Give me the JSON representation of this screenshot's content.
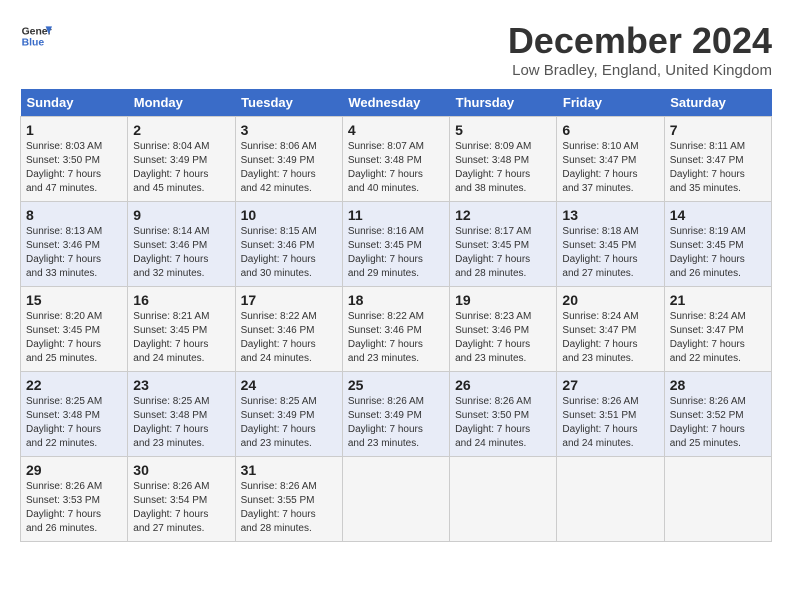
{
  "header": {
    "logo_line1": "General",
    "logo_line2": "Blue",
    "title": "December 2024",
    "subtitle": "Low Bradley, England, United Kingdom"
  },
  "days_of_week": [
    "Sunday",
    "Monday",
    "Tuesday",
    "Wednesday",
    "Thursday",
    "Friday",
    "Saturday"
  ],
  "weeks": [
    [
      {
        "day": "1",
        "info": "Sunrise: 8:03 AM\nSunset: 3:50 PM\nDaylight: 7 hours\nand 47 minutes."
      },
      {
        "day": "2",
        "info": "Sunrise: 8:04 AM\nSunset: 3:49 PM\nDaylight: 7 hours\nand 45 minutes."
      },
      {
        "day": "3",
        "info": "Sunrise: 8:06 AM\nSunset: 3:49 PM\nDaylight: 7 hours\nand 42 minutes."
      },
      {
        "day": "4",
        "info": "Sunrise: 8:07 AM\nSunset: 3:48 PM\nDaylight: 7 hours\nand 40 minutes."
      },
      {
        "day": "5",
        "info": "Sunrise: 8:09 AM\nSunset: 3:48 PM\nDaylight: 7 hours\nand 38 minutes."
      },
      {
        "day": "6",
        "info": "Sunrise: 8:10 AM\nSunset: 3:47 PM\nDaylight: 7 hours\nand 37 minutes."
      },
      {
        "day": "7",
        "info": "Sunrise: 8:11 AM\nSunset: 3:47 PM\nDaylight: 7 hours\nand 35 minutes."
      }
    ],
    [
      {
        "day": "8",
        "info": "Sunrise: 8:13 AM\nSunset: 3:46 PM\nDaylight: 7 hours\nand 33 minutes."
      },
      {
        "day": "9",
        "info": "Sunrise: 8:14 AM\nSunset: 3:46 PM\nDaylight: 7 hours\nand 32 minutes."
      },
      {
        "day": "10",
        "info": "Sunrise: 8:15 AM\nSunset: 3:46 PM\nDaylight: 7 hours\nand 30 minutes."
      },
      {
        "day": "11",
        "info": "Sunrise: 8:16 AM\nSunset: 3:45 PM\nDaylight: 7 hours\nand 29 minutes."
      },
      {
        "day": "12",
        "info": "Sunrise: 8:17 AM\nSunset: 3:45 PM\nDaylight: 7 hours\nand 28 minutes."
      },
      {
        "day": "13",
        "info": "Sunrise: 8:18 AM\nSunset: 3:45 PM\nDaylight: 7 hours\nand 27 minutes."
      },
      {
        "day": "14",
        "info": "Sunrise: 8:19 AM\nSunset: 3:45 PM\nDaylight: 7 hours\nand 26 minutes."
      }
    ],
    [
      {
        "day": "15",
        "info": "Sunrise: 8:20 AM\nSunset: 3:45 PM\nDaylight: 7 hours\nand 25 minutes."
      },
      {
        "day": "16",
        "info": "Sunrise: 8:21 AM\nSunset: 3:45 PM\nDaylight: 7 hours\nand 24 minutes."
      },
      {
        "day": "17",
        "info": "Sunrise: 8:22 AM\nSunset: 3:46 PM\nDaylight: 7 hours\nand 24 minutes."
      },
      {
        "day": "18",
        "info": "Sunrise: 8:22 AM\nSunset: 3:46 PM\nDaylight: 7 hours\nand 23 minutes."
      },
      {
        "day": "19",
        "info": "Sunrise: 8:23 AM\nSunset: 3:46 PM\nDaylight: 7 hours\nand 23 minutes."
      },
      {
        "day": "20",
        "info": "Sunrise: 8:24 AM\nSunset: 3:47 PM\nDaylight: 7 hours\nand 23 minutes."
      },
      {
        "day": "21",
        "info": "Sunrise: 8:24 AM\nSunset: 3:47 PM\nDaylight: 7 hours\nand 22 minutes."
      }
    ],
    [
      {
        "day": "22",
        "info": "Sunrise: 8:25 AM\nSunset: 3:48 PM\nDaylight: 7 hours\nand 22 minutes."
      },
      {
        "day": "23",
        "info": "Sunrise: 8:25 AM\nSunset: 3:48 PM\nDaylight: 7 hours\nand 23 minutes."
      },
      {
        "day": "24",
        "info": "Sunrise: 8:25 AM\nSunset: 3:49 PM\nDaylight: 7 hours\nand 23 minutes."
      },
      {
        "day": "25",
        "info": "Sunrise: 8:26 AM\nSunset: 3:49 PM\nDaylight: 7 hours\nand 23 minutes."
      },
      {
        "day": "26",
        "info": "Sunrise: 8:26 AM\nSunset: 3:50 PM\nDaylight: 7 hours\nand 24 minutes."
      },
      {
        "day": "27",
        "info": "Sunrise: 8:26 AM\nSunset: 3:51 PM\nDaylight: 7 hours\nand 24 minutes."
      },
      {
        "day": "28",
        "info": "Sunrise: 8:26 AM\nSunset: 3:52 PM\nDaylight: 7 hours\nand 25 minutes."
      }
    ],
    [
      {
        "day": "29",
        "info": "Sunrise: 8:26 AM\nSunset: 3:53 PM\nDaylight: 7 hours\nand 26 minutes."
      },
      {
        "day": "30",
        "info": "Sunrise: 8:26 AM\nSunset: 3:54 PM\nDaylight: 7 hours\nand 27 minutes."
      },
      {
        "day": "31",
        "info": "Sunrise: 8:26 AM\nSunset: 3:55 PM\nDaylight: 7 hours\nand 28 minutes."
      },
      {
        "day": "",
        "info": ""
      },
      {
        "day": "",
        "info": ""
      },
      {
        "day": "",
        "info": ""
      },
      {
        "day": "",
        "info": ""
      }
    ]
  ]
}
